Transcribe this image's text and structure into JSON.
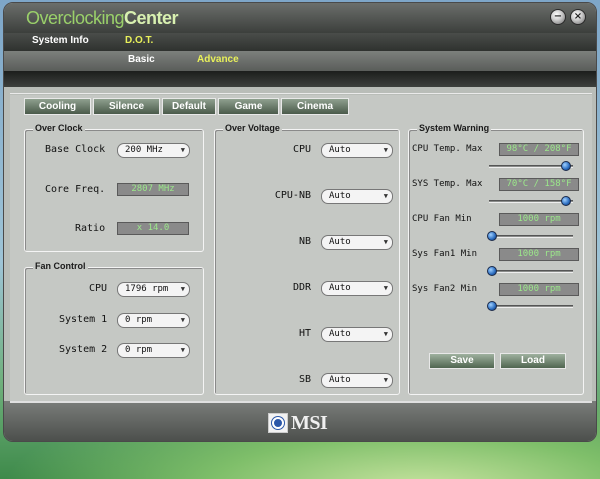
{
  "app": {
    "title_part1": "Overclocking",
    "title_part2": "Center",
    "minimize_glyph": "−",
    "close_glyph": "×"
  },
  "tabs_top": [
    {
      "label": "System Info",
      "active": false
    },
    {
      "label": "D.O.T.",
      "active": true
    }
  ],
  "tabs_sub": [
    {
      "label": "Basic",
      "active": false
    },
    {
      "label": "Advance",
      "active": true
    }
  ],
  "presets": [
    "Cooling",
    "Silence",
    "Default",
    "Game",
    "Cinema"
  ],
  "over_clock": {
    "title": "Over Clock",
    "base_clock_label": "Base Clock",
    "base_clock_value": "200 MHz",
    "core_freq_label": "Core Freq.",
    "core_freq_value": "2807 MHz",
    "ratio_label": "Ratio",
    "ratio_value": "x 14.0"
  },
  "fan_control": {
    "title": "Fan Control",
    "cpu_label": "CPU",
    "cpu_value": "1796 rpm",
    "system1_label": "System 1",
    "system1_value": "0 rpm",
    "system2_label": "System 2",
    "system2_value": "0 rpm"
  },
  "over_voltage": {
    "title": "Over Voltage",
    "items": [
      {
        "label": "CPU",
        "value": "Auto"
      },
      {
        "label": "CPU-NB",
        "value": "Auto"
      },
      {
        "label": "NB",
        "value": "Auto"
      },
      {
        "label": "DDR",
        "value": "Auto"
      },
      {
        "label": "HT",
        "value": "Auto"
      },
      {
        "label": "SB",
        "value": "Auto"
      }
    ]
  },
  "system_warning": {
    "title": "System Warning",
    "items": [
      {
        "label": "CPU Temp. Max",
        "value": "98°C / 208°F",
        "level": 0.92
      },
      {
        "label": "SYS Temp. Max",
        "value": "70°C / 158°F",
        "level": 0.92
      },
      {
        "label": "CPU Fan Min",
        "value": "1000 rpm",
        "level": 0.04
      },
      {
        "label": "Sys Fan1 Min",
        "value": "1000 rpm",
        "level": 0.04
      },
      {
        "label": "Sys Fan2 Min",
        "value": "1000 rpm",
        "level": 0.04
      }
    ],
    "save_label": "Save",
    "load_label": "Load"
  },
  "footer": {
    "logo_text": "MSI"
  },
  "colors": {
    "active_tab": "#e8f05a",
    "inactive_tab": "#ffffff",
    "display_text": "#9be88a"
  },
  "icons": [
    "minimize-icon",
    "close-icon",
    "dropdown-arrow-icon",
    "slider-knob-icon",
    "msi-logo-icon"
  ]
}
